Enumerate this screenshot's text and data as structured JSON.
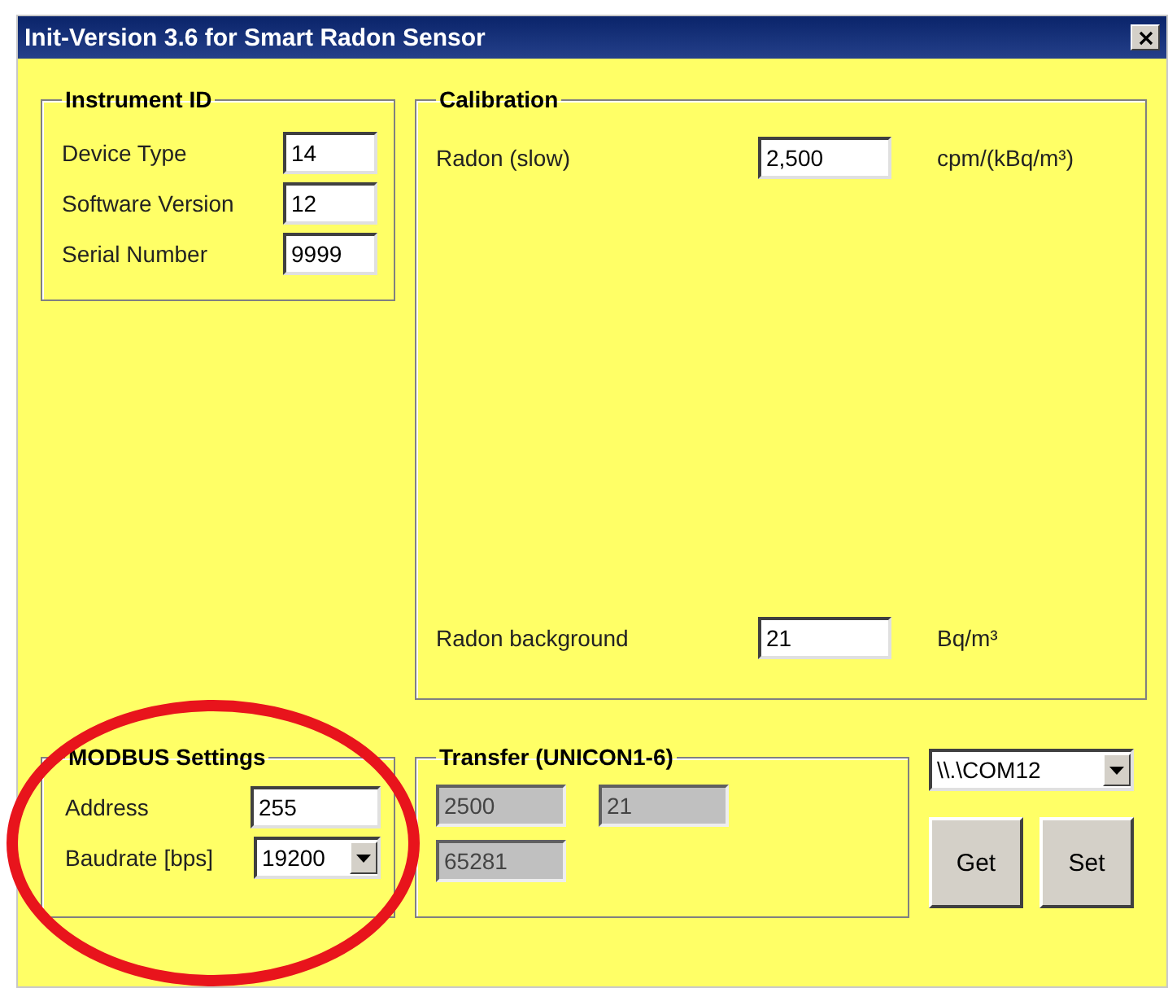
{
  "window": {
    "title": "Init-Version 3.6 for Smart Radon Sensor"
  },
  "instrument_id": {
    "title": "Instrument ID",
    "fields": [
      {
        "label": "Device Type",
        "value": "14"
      },
      {
        "label": "Software Version",
        "value": "12"
      },
      {
        "label": "Serial Number",
        "value": "9999"
      }
    ]
  },
  "calibration": {
    "title": "Calibration",
    "rows": [
      {
        "label": "Radon (slow)",
        "value": "2,500",
        "unit": "cpm/(kBq/m³)"
      },
      {
        "label": "Radon background",
        "value": "21",
        "unit": "Bq/m³"
      }
    ]
  },
  "modbus": {
    "title": "MODBUS Settings",
    "fields": [
      {
        "kind": "text",
        "label": "Address",
        "value": "255"
      },
      {
        "kind": "dropdown",
        "label": "Baudrate [bps]",
        "value": "19200"
      }
    ]
  },
  "transfer": {
    "title": "Transfer (UNICON1-6)",
    "fields": [
      {
        "value": "2500",
        "disabled": true
      },
      {
        "value": "21",
        "disabled": true
      },
      {
        "value": "65281",
        "disabled": true
      }
    ]
  },
  "port": {
    "value": "\\\\.\\COM12"
  },
  "buttons": [
    "Get",
    "Set"
  ]
}
